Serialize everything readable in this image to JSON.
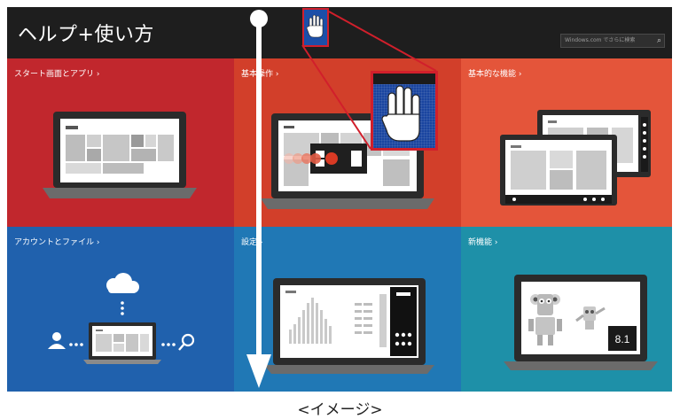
{
  "app": {
    "title": "ヘルプ+使い方"
  },
  "search": {
    "placeholder": "Windows.com でさらに検索"
  },
  "tiles": [
    {
      "label": "スタート画面とアプリ ›",
      "color": "#c1272d"
    },
    {
      "label": "基本操作 ›",
      "color": "#d23f2a"
    },
    {
      "label": "基本的な機能 ›",
      "color": "#e4553a"
    },
    {
      "label": "アカウントとファイル ›",
      "color": "#2061ad"
    },
    {
      "label": "設定 ›",
      "color": "#2078b5"
    },
    {
      "label": "新機能 ›",
      "color": "#1e90a8"
    }
  ],
  "new_features": {
    "version": "8.1"
  },
  "caption": "<イメージ>",
  "icons": [
    "search-icon",
    "hand-cursor-icon",
    "cloud-icon",
    "user-icon",
    "magnifier-icon",
    "robot-icon"
  ],
  "colors": {
    "annotation_red": "#d11f2b",
    "arrow": "#ffffff",
    "topbar": "#1e1e1e"
  }
}
